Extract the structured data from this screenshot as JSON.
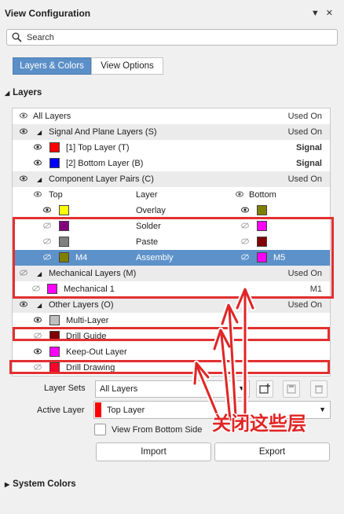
{
  "panel": {
    "title": "View Configuration"
  },
  "search": {
    "placeholder": "Search"
  },
  "tabs": [
    {
      "label": "Layers & Colors"
    },
    {
      "label": "View Options"
    }
  ],
  "layers_section": {
    "title": "Layers"
  },
  "table": {
    "all_layers": "All Layers",
    "used_on_header": "Used On",
    "signal_group": {
      "label": "Signal And Plane Layers (S)",
      "used_on": "Used On"
    },
    "signal_layers": [
      {
        "name": "[1] Top Layer (T)",
        "used_on": "Signal",
        "color": "#ff0000"
      },
      {
        "name": "[2] Bottom Layer (B)",
        "used_on": "Signal",
        "color": "#0000ff"
      }
    ],
    "pairs_group": {
      "label": "Component Layer Pairs (C)",
      "used_on": "Used On"
    },
    "pairs_header": {
      "top": "Top",
      "layer": "Layer",
      "bottom": "Bottom"
    },
    "pairs": [
      {
        "top_color": "#ffff00",
        "layer": "Overlay",
        "bottom_color": "#808000",
        "top_name": "",
        "bottom_name": ""
      },
      {
        "top_color": "#800080",
        "layer": "Solder",
        "bottom_color": "#ff00ff",
        "top_name": "",
        "bottom_name": ""
      },
      {
        "top_color": "#808080",
        "layer": "Paste",
        "bottom_color": "#800000",
        "top_name": "",
        "bottom_name": ""
      },
      {
        "top_color": "#808000",
        "layer": "Assembly",
        "bottom_color": "#ff00ff",
        "top_name": "M4",
        "bottom_name": "M5"
      }
    ],
    "mechanical_group": {
      "label": "Mechanical Layers (M)",
      "used_on": "Used On"
    },
    "mechanical_layers": [
      {
        "name": "Mechanical 1",
        "used_on": "M1",
        "color": "#ff00ff"
      }
    ],
    "other_group": {
      "label": "Other Layers (O)",
      "used_on": "Used On"
    },
    "other_layers": [
      {
        "name": "Multi-Layer",
        "color": "#c0c0c0"
      },
      {
        "name": "Drill Guide",
        "color": "#800000"
      },
      {
        "name": "Keep-Out Layer",
        "color": "#ff00ff"
      },
      {
        "name": "Drill Drawing",
        "color": "#ff002a"
      }
    ]
  },
  "layer_sets": {
    "label": "Layer Sets",
    "value": "All Layers"
  },
  "active_layer": {
    "label": "Active Layer",
    "value": "Top Layer",
    "color": "#ff0000"
  },
  "view_from_bottom": {
    "label": "View From Bottom Side"
  },
  "buttons": {
    "import": "Import",
    "export": "Export"
  },
  "system_colors": {
    "title": "System Colors"
  },
  "annotation": {
    "text": "关闭这些层",
    "color": "#e02525"
  }
}
